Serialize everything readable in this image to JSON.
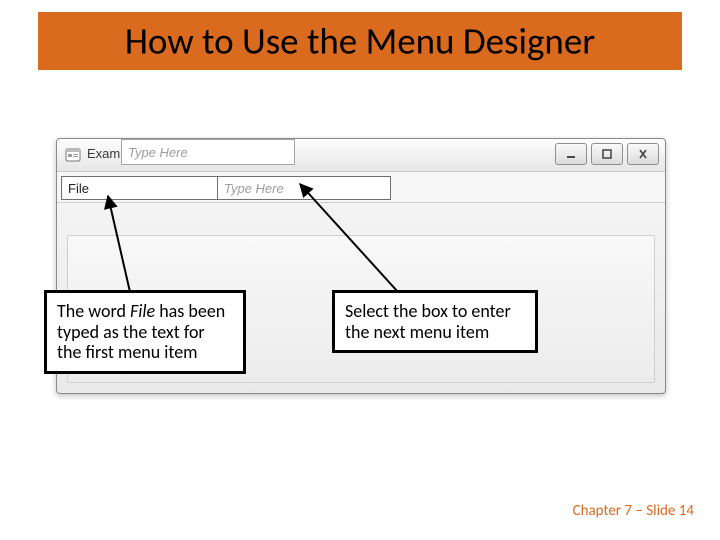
{
  "title": "How to Use the Menu Designer",
  "window": {
    "title": "Example Menu System",
    "menu": {
      "first_item": "File",
      "placeholder_right": "Type Here",
      "placeholder_below": "Type Here"
    },
    "controls": {
      "minimize": "minimize",
      "maximize": "maximize",
      "close": "close"
    }
  },
  "callouts": {
    "left_html": "The word <i>File</i> has been typed as the text for the first menu item",
    "left_plain": "The word File has been typed as the text for the first menu item",
    "right": "Select the box to enter the next menu item"
  },
  "footer": "Chapter 7 – Slide 14",
  "colors": {
    "accent": "#d96a1e"
  }
}
